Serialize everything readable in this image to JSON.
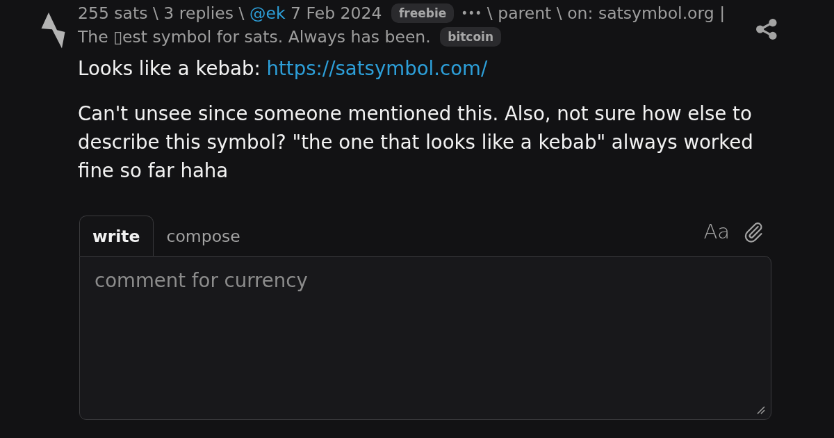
{
  "item": {
    "meta": [
      {
        "items": [
          {
            "kind": "count",
            "text": "255 sats"
          },
          {
            "kind": "sep",
            "text": "\\"
          },
          {
            "kind": "count",
            "text": "3 replies"
          },
          {
            "kind": "sep",
            "text": "\\"
          },
          {
            "kind": "user",
            "text": "@ek"
          },
          {
            "kind": "date",
            "text": "7 Feb 2024"
          },
          {
            "kind": "tag",
            "text": "freebie"
          },
          {
            "kind": "menu",
            "text": "•••"
          },
          {
            "kind": "sep",
            "text": "\\"
          },
          {
            "kind": "link",
            "text": "parent"
          },
          {
            "kind": "sep",
            "text": "\\"
          },
          {
            "kind": "label",
            "text": "on:"
          },
          {
            "kind": "title",
            "text": "satsymbol.org |"
          }
        ]
      },
      {
        "items": [
          {
            "kind": "title",
            "text": "The ▯est symbol for sats. Always has been."
          },
          {
            "kind": "tag",
            "text": "bitcoin"
          }
        ]
      }
    ],
    "body": [
      {
        "text": "Looks like a kebab:",
        "link": "https://satsymbol.com/"
      },
      {
        "text": "Can't unsee since someone mentioned this. Also, not sure how else to describe this symbol? \"the one that looks like a kebab\" always worked fine so far haha"
      }
    ]
  },
  "editor": {
    "tabs": [
      {
        "label": "write",
        "selected": true
      },
      {
        "label": "compose",
        "selected": false
      }
    ],
    "format_label": "Aa",
    "placeholder": "comment for currency"
  }
}
